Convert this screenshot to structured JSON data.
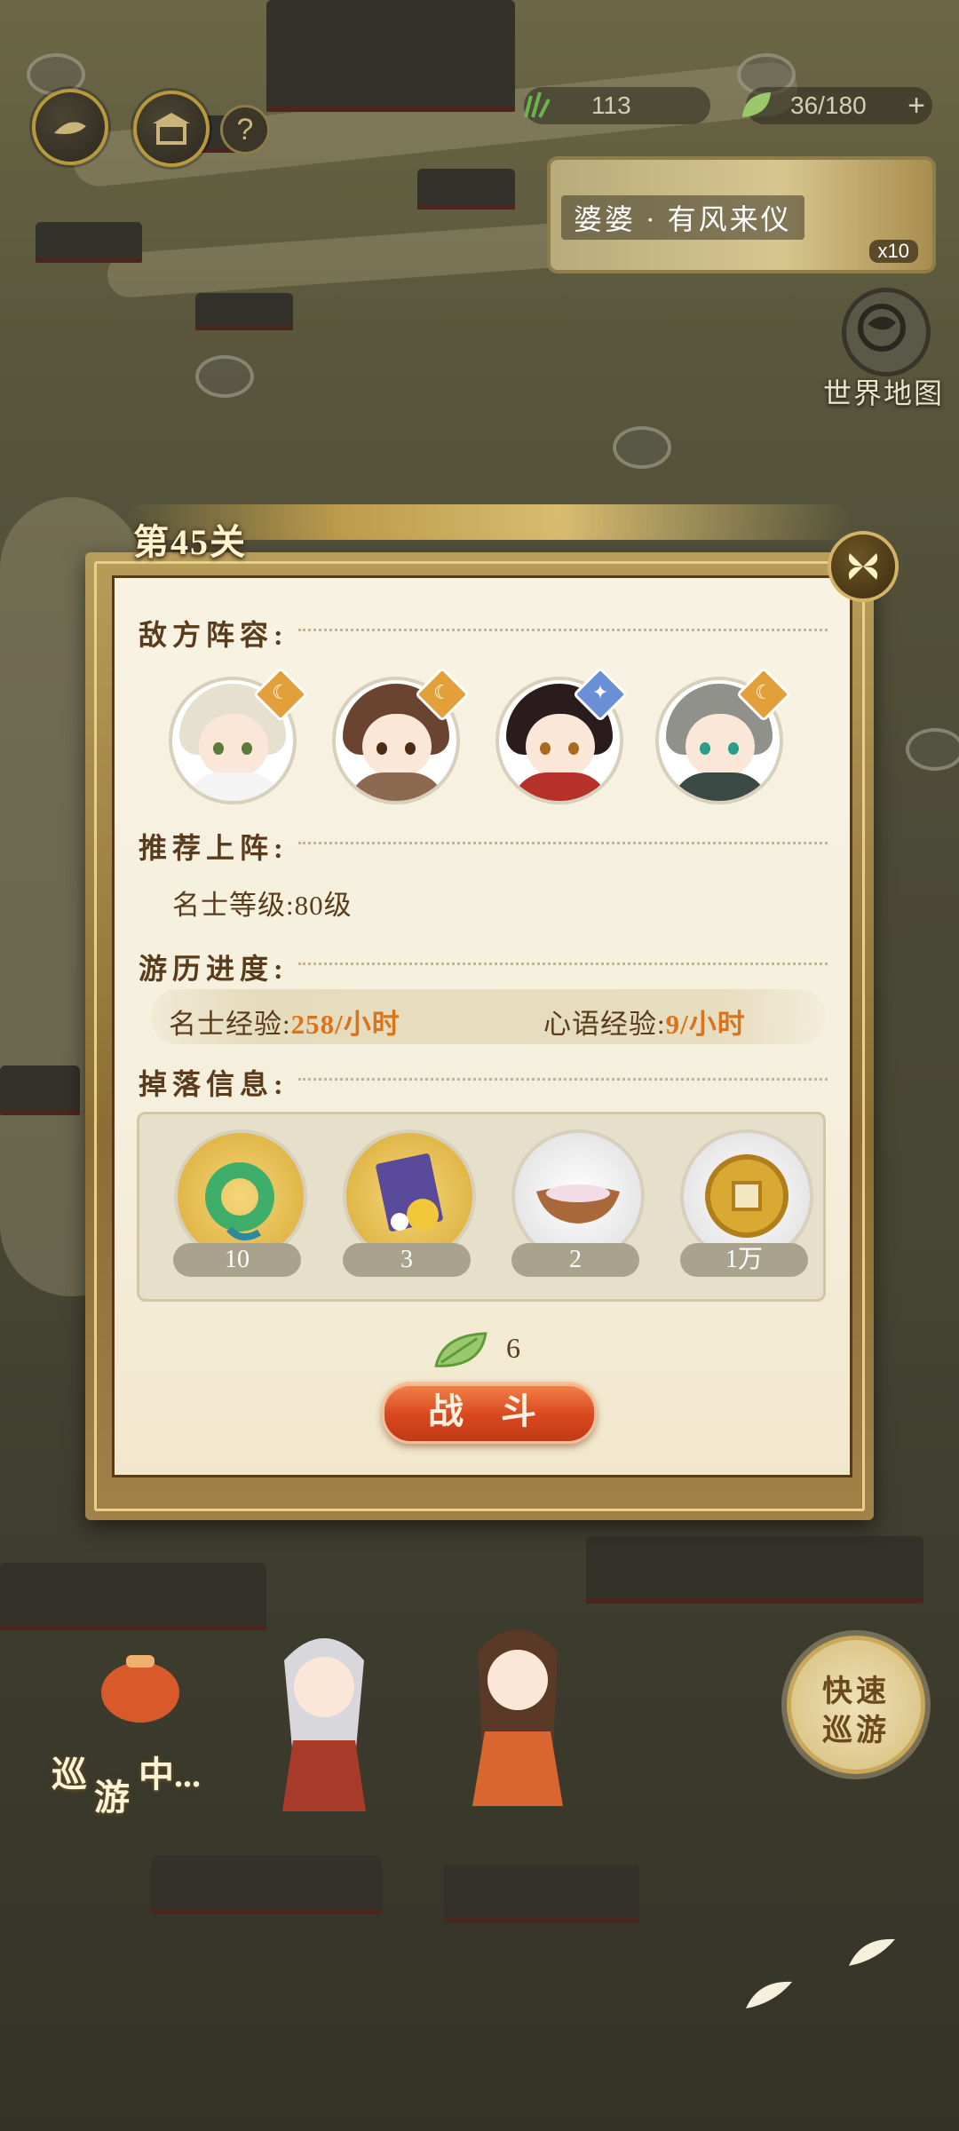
{
  "hud": {
    "resource_1_value": "113",
    "stamina_value": "36/180",
    "add_symbol": "+",
    "help_symbol": "?"
  },
  "event": {
    "title": "婆婆 · 有风来仪",
    "count": "x10"
  },
  "world_map": {
    "label": "世界地图"
  },
  "stage": {
    "title": "第45关",
    "enemy_section": "敌方阵容:",
    "recommend_section": "推荐上阵:",
    "recommend_level_label": "名士等级:",
    "recommend_level_value": "80级",
    "progress_section": "游历进度:",
    "exp_label": "名士经验:",
    "exp_value": "258/小时",
    "heart_exp_label": "心语经验:",
    "heart_exp_value": "9/小时",
    "drop_section": "掉落信息:",
    "drops": [
      {
        "name": "jade-pendant",
        "count": "10"
      },
      {
        "name": "scroll-chrysanthemum",
        "count": "3"
      },
      {
        "name": "rice-bowl",
        "count": "2"
      },
      {
        "name": "copper-coin",
        "count": "1万"
      }
    ],
    "cost_value": "6",
    "fight_label": "战 斗"
  },
  "scene": {
    "travel_char_1": "巡",
    "travel_char_2": "游",
    "travel_char_3": "中...",
    "quick_line_1": "快速",
    "quick_line_2": "巡游"
  },
  "colors": {
    "accent_orange": "#d9731c",
    "fight_button": "#d9471f",
    "panel_bg": "#f7f2e2",
    "section_title": "#5a3b1c"
  }
}
